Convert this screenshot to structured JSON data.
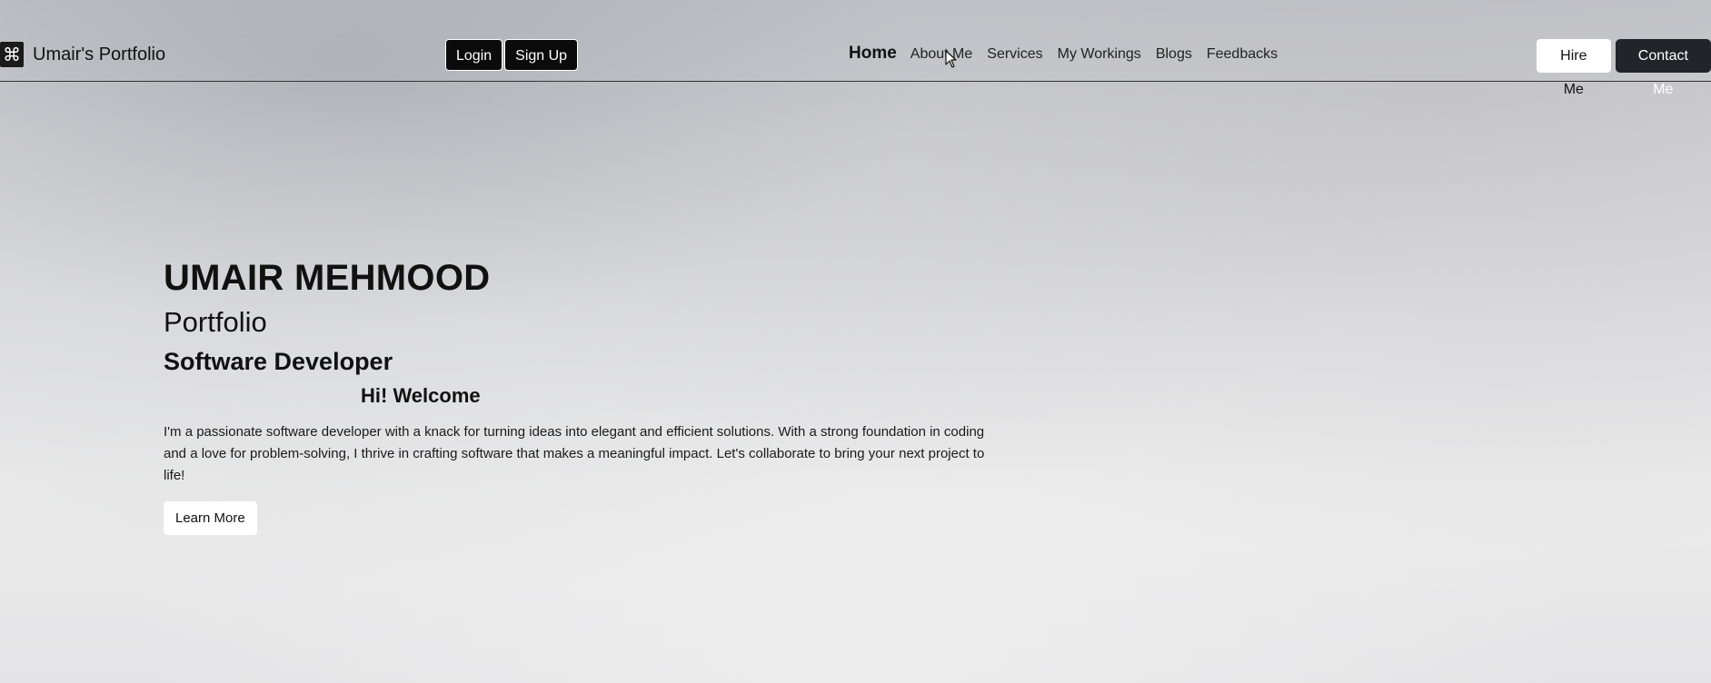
{
  "navbar": {
    "brand_icon": "⌘",
    "brand_text": "Umair's Portfolio",
    "login_label": "Login",
    "signup_label": "Sign Up",
    "links": [
      {
        "label": "Home",
        "active": true
      },
      {
        "label": "About Me",
        "active": false
      },
      {
        "label": "Services",
        "active": false
      },
      {
        "label": "My Workings",
        "active": false
      },
      {
        "label": "Blogs",
        "active": false
      },
      {
        "label": "Feedbacks",
        "active": false
      }
    ],
    "hire_label": "Hire Me",
    "contact_label": "Contact Me"
  },
  "hero": {
    "name": "UMAIR MEHMOOD",
    "subtitle1": "Portfolio",
    "subtitle2": "Software Developer",
    "welcome": "Hi! Welcome",
    "description": "I'm a passionate software developer with a knack for turning ideas into elegant and efficient solutions. With a strong foundation in coding and a love for problem-solving, I thrive in crafting software that makes a meaningful impact. Let's collaborate to bring your next project to life!",
    "button_label": "Learn More"
  },
  "colors": {
    "dark_button": "#0b0b0b",
    "contact_button": "#212529",
    "light_button": "#ffffff"
  },
  "icons": {
    "brand": "command-icon",
    "cursor": "mouse-cursor-icon"
  }
}
